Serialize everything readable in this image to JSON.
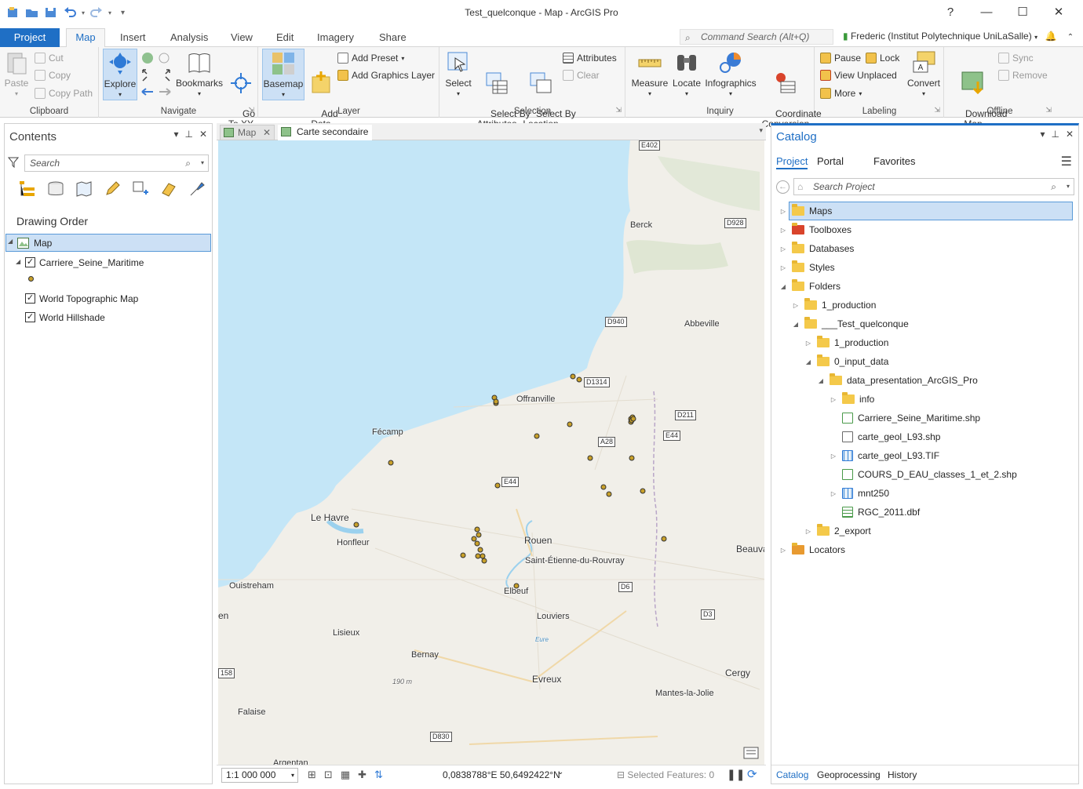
{
  "window": {
    "title": "Test_quelconque - Map - ArcGIS Pro",
    "controls": [
      "?",
      "—",
      "☐",
      "✕"
    ]
  },
  "tabs": {
    "project": "Project",
    "items": [
      "Map",
      "Insert",
      "Analysis",
      "View",
      "Edit",
      "Imagery",
      "Share"
    ],
    "active": "Map"
  },
  "command_search": {
    "placeholder": "Command Search (Alt+Q)"
  },
  "user": {
    "name": "Frederic (Institut Polytechnique UniLaSalle)"
  },
  "ribbon": {
    "clipboard": {
      "label": "Clipboard",
      "paste": "Paste",
      "cut": "Cut",
      "copy": "Copy",
      "copy_path": "Copy Path"
    },
    "navigate": {
      "label": "Navigate",
      "explore": "Explore",
      "bookmarks": "Bookmarks",
      "go_to_xy": "Go\nTo XY"
    },
    "layer": {
      "label": "Layer",
      "basemap": "Basemap",
      "add_data": "Add\nData",
      "add_preset": "Add Preset",
      "add_graphics_layer": "Add Graphics Layer"
    },
    "selection": {
      "label": "Selection",
      "select": "Select",
      "select_by_attributes": "Select By\nAttributes",
      "select_by_location": "Select By\nLocation",
      "attributes": "Attributes",
      "clear": "Clear"
    },
    "inquiry": {
      "label": "Inquiry",
      "measure": "Measure",
      "locate": "Locate",
      "infographics": "Infographics",
      "coordinate_conversion": "Coordinate\nConversion"
    },
    "labeling": {
      "label": "Labeling",
      "pause": "Pause",
      "lock": "Lock",
      "view_unplaced": "View Unplaced",
      "more": "More",
      "convert": "Convert"
    },
    "offline": {
      "label": "Offline",
      "download_map": "Download\nMap",
      "sync": "Sync",
      "remove": "Remove"
    }
  },
  "contents": {
    "title": "Contents",
    "search_placeholder": "Search",
    "section": "Drawing Order",
    "map_name": "Map",
    "layers": [
      "Carriere_Seine_Maritime",
      "World Topographic Map",
      "World Hillshade"
    ]
  },
  "map_view": {
    "tabs": [
      "Map",
      "Carte secondaire"
    ],
    "scale": "1:1 000 000",
    "coordinates": "0,0838788°E 50,6492422°N",
    "selected_features": "Selected Features: 0",
    "places": [
      "Berck",
      "Abbeville",
      "Offranville",
      "Fécamp",
      "Le Havre",
      "Honfleur",
      "Rouen",
      "Saint-Étienne-du-Rouvray",
      "Elbeuf",
      "Louviers",
      "Ouistreham",
      "Lisieux",
      "Bernay",
      "Evreux",
      "Cergy",
      "Mantes-la-Jolie",
      "Falaise",
      "Beauva",
      "en",
      "Argentan",
      "190 m",
      "Eure"
    ],
    "roads": [
      "E402",
      "D928",
      "D940",
      "D1314",
      "D211",
      "E44",
      "A28",
      "E44",
      "D6",
      "D3",
      "158",
      "D830"
    ]
  },
  "catalog": {
    "title": "Catalog",
    "tabs": [
      "Project",
      "Portal",
      "Favorites"
    ],
    "search_placeholder": "Search Project",
    "tree": [
      "Maps",
      "Toolboxes",
      "Databases",
      "Styles",
      "Folders",
      "1_production",
      "___Test_quelconque",
      "1_production",
      "0_input_data",
      "data_presentation_ArcGIS_Pro",
      "info",
      "Carriere_Seine_Maritime.shp",
      "carte_geol_L93.shp",
      "carte_geol_L93.TIF",
      "COURS_D_EAU_classes_1_et_2.shp",
      "mnt250",
      "RGC_2011.dbf",
      "2_export",
      "Locators"
    ],
    "bottom_tabs": [
      "Catalog",
      "Geoprocessing",
      "History"
    ]
  },
  "colors": {
    "accent": "#1f6fc5",
    "sea": "#c4e6f7",
    "land": "#f1efe9",
    "point_fill": "#c8a02a"
  }
}
